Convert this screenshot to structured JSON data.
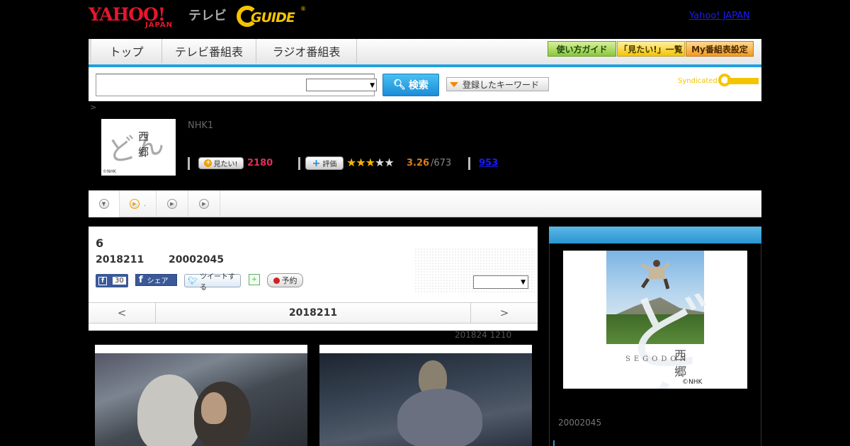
{
  "header": {
    "logo_yahoo": "YAHOO!",
    "logo_japan": "JAPAN",
    "logo_tv": "テレビ",
    "logo_gguide": "GUIDE",
    "logo_reg": "®",
    "yahoo_japan_link": "Yahoo! JAPAN"
  },
  "nav": {
    "tabs": [
      "トップ",
      "テレビ番組表",
      "ラジオ番組表"
    ],
    "buttons": [
      "使い方ガイド",
      "「見たい!」一覧",
      "My番組表設定"
    ]
  },
  "search": {
    "input_value": "",
    "select_value": "",
    "button_label": "検索",
    "keywords_label": "登録したキーワード",
    "syndicated_label": "Syndicated"
  },
  "breadcrumb": ">",
  "program": {
    "thumb_kanji_1": "西",
    "thumb_kanji_2": "郷",
    "thumb_brush": "どん",
    "thumb_copyright": "©NHK",
    "channel": "NHK1",
    "mitai_label": "見たい!",
    "mitai_count": "2180",
    "hyoka_label": "評価",
    "rating": "3.26",
    "rating_denominator": "/673",
    "review_count": "953",
    "stars_filled": 3,
    "stars_total": 5
  },
  "episode": {
    "number": "6",
    "date": "2018211",
    "time": "20002045",
    "fb_like_count": "30",
    "fb_share_label": "シェア",
    "tweet_label": "ツイートする",
    "reserve_label": "予約",
    "select_value": "",
    "pager_prev": "<",
    "pager_current": "2018211",
    "pager_next": ">",
    "update_note": "201824  1210"
  },
  "side": {
    "poster_kanji_1": "西",
    "poster_kanji_2": "郷",
    "poster_segodon": "SEGODON",
    "poster_brush": "どん",
    "poster_copyright": "©NHK",
    "airtime": "20002045"
  },
  "colors": {
    "accent_blue": "#20a0e0",
    "yahoo_red": "#e6162e",
    "gguide_yellow": "#f5c400",
    "mitai_pink": "#e0305a",
    "rating_orange": "#d87d1a"
  }
}
